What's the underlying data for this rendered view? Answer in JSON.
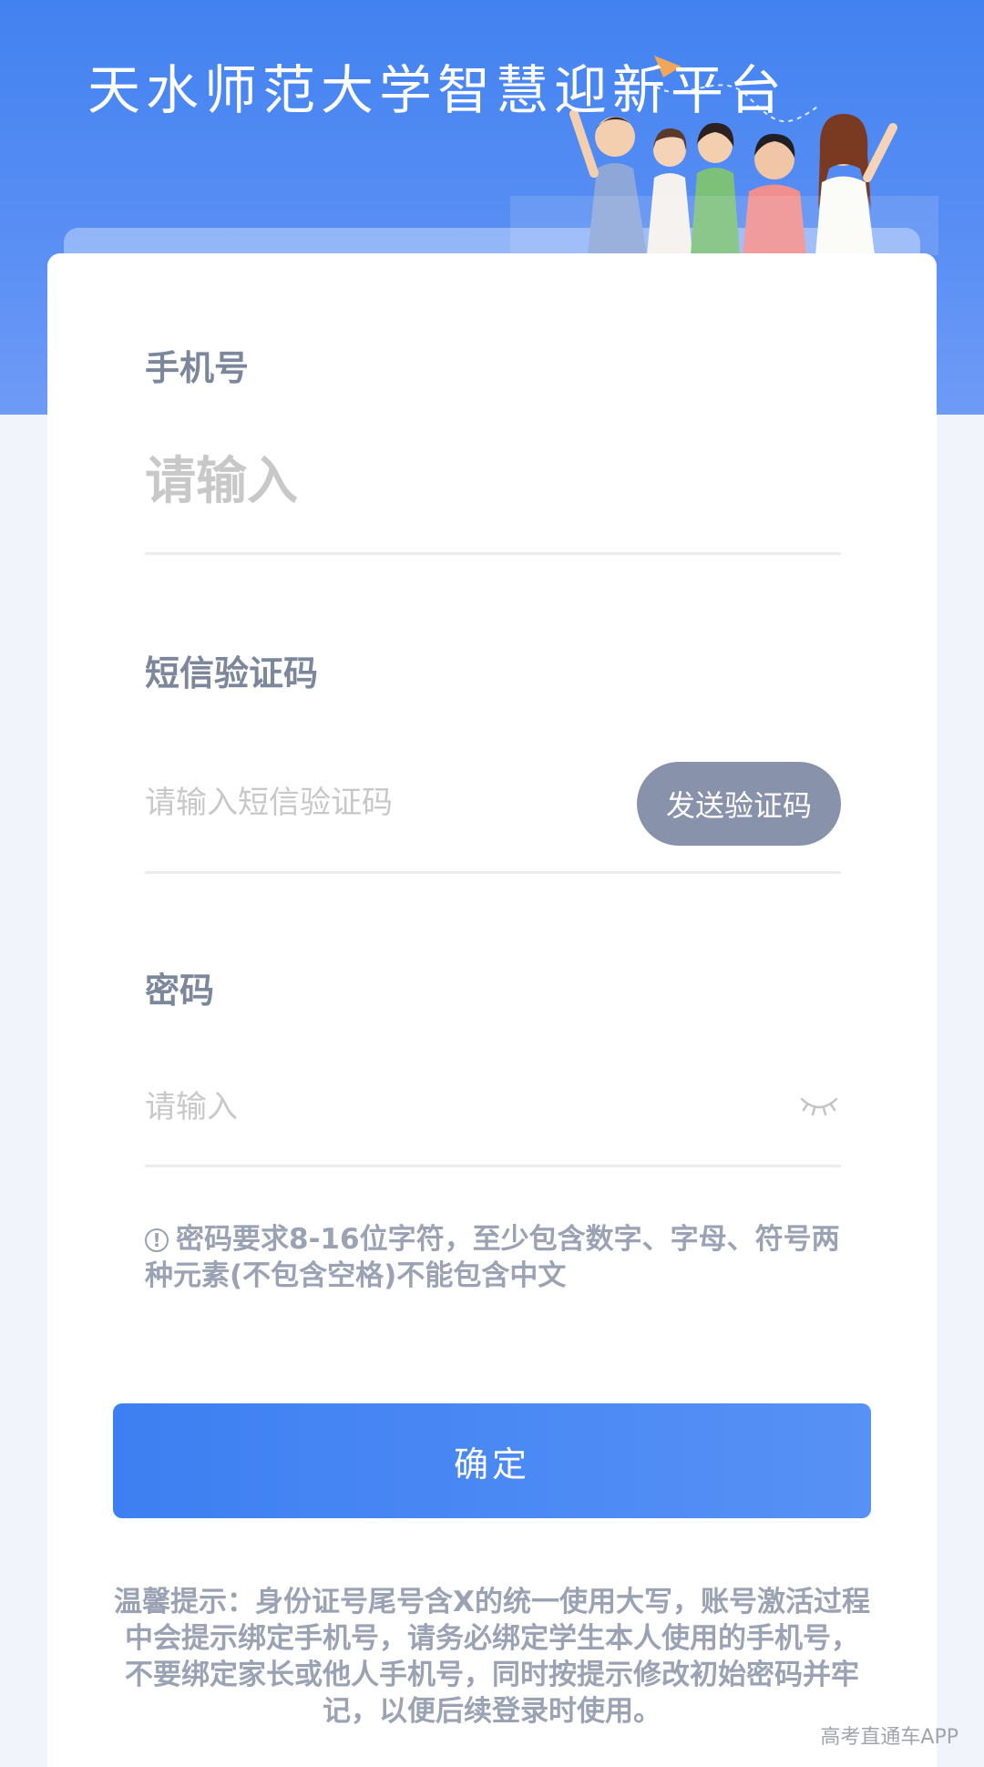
{
  "header": {
    "title": "天水师范大学智慧迎新平台"
  },
  "form": {
    "phone": {
      "label": "手机号",
      "placeholder": "请输入"
    },
    "sms": {
      "label": "短信验证码",
      "placeholder": "请输入短信验证码",
      "send_button": "发送验证码"
    },
    "password": {
      "label": "密码",
      "placeholder": "请输入",
      "visibility_icon": "eye-closed-icon",
      "hint": "密码要求8-16位字符，至少包含数字、字母、符号两种元素(不包含空格)不能包含中文",
      "hint_icon_glyph": "!"
    },
    "confirm_label": "确定"
  },
  "footer": {
    "tip": "温馨提示：身份证号尾号含X的统一使用大写，账号激活过程中会提示绑定手机号，请务必绑定学生本人使用的手机号，不要绑定家长或他人手机号，同时按提示修改初始密码并牢记，以便后续登录时使用。"
  },
  "watermark": "高考直通车APP",
  "colors": {
    "header_blue": "#4282f0",
    "button_blue": "#3d7ff2",
    "send_button_gray": "#8892ab",
    "label_gray": "#7d879b"
  }
}
